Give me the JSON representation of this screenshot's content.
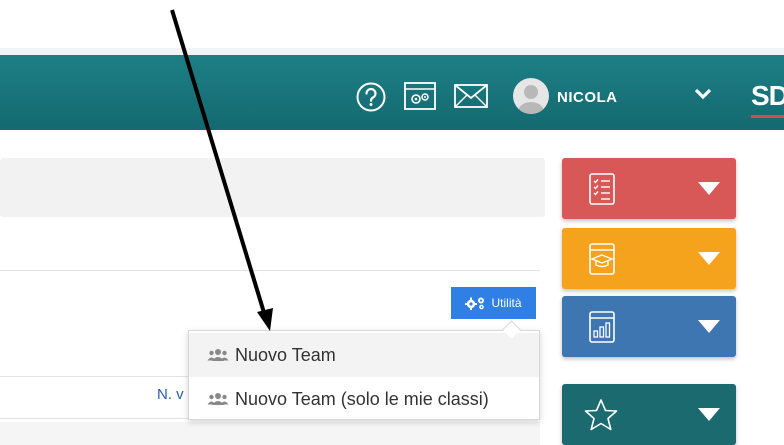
{
  "header": {
    "user_name": "NICOLA",
    "brand": "SD",
    "icons": [
      "help-icon",
      "settings-window-icon",
      "mail-icon",
      "avatar",
      "chevron-down-icon"
    ]
  },
  "toolbar": {
    "utility_label": "Utilità"
  },
  "table": {
    "view_link_label": "N. v"
  },
  "dropdown": {
    "items": [
      {
        "label": "Nuovo Team",
        "icon": "users-icon"
      },
      {
        "label": "Nuovo Team (solo le mie classi)",
        "icon": "users-icon"
      }
    ]
  },
  "tiles": [
    {
      "name": "registro",
      "icon": "checklist-icon",
      "color": "#d85757"
    },
    {
      "name": "didattica",
      "icon": "graduation-cap-icon",
      "color": "#f5a21c"
    },
    {
      "name": "statistiche",
      "icon": "chart-icon",
      "color": "#3d76b0"
    },
    {
      "name": "preferiti",
      "icon": "star-icon",
      "color": "#1b6a70"
    }
  ],
  "colors": {
    "header": "#1d7f85",
    "utility_button": "#2f7fe4",
    "annotation_arrow": "#000000"
  }
}
